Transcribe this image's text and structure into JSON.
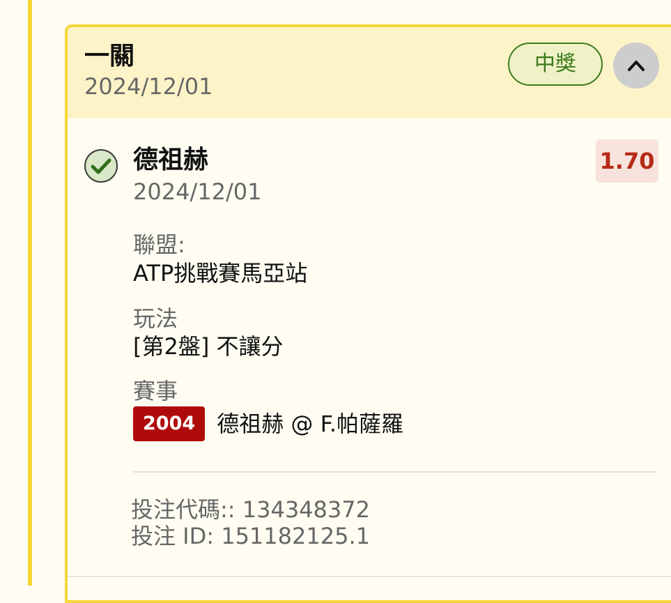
{
  "bet": {
    "type": "一關",
    "date": "2024/12/01",
    "status": "中獎"
  },
  "selection": {
    "name": "德祖赫",
    "date": "2024/12/01",
    "odds": "1.70"
  },
  "details": {
    "league_label": "聯盟:",
    "league_value": "ATP挑戰賽馬亞站",
    "bettype_label": "玩法",
    "bettype_value": "[第2盤] 不讓分",
    "event_label": "賽事",
    "event_id": "2004",
    "event_name": "德祖赫 @ F.帕薩羅"
  },
  "footer": {
    "bet_code": "投注代碼:: 134348372",
    "bet_id": "投注 ID: 151182125.1"
  },
  "icons": {
    "check": "check-circle-icon",
    "collapse": "chevron-up-icon"
  },
  "colors": {
    "accent": "#f5d637",
    "header_bg": "#fdf3c8",
    "win_green": "#3b7a1c",
    "odds_red": "#b52a16",
    "event_badge": "#b00b0b"
  }
}
